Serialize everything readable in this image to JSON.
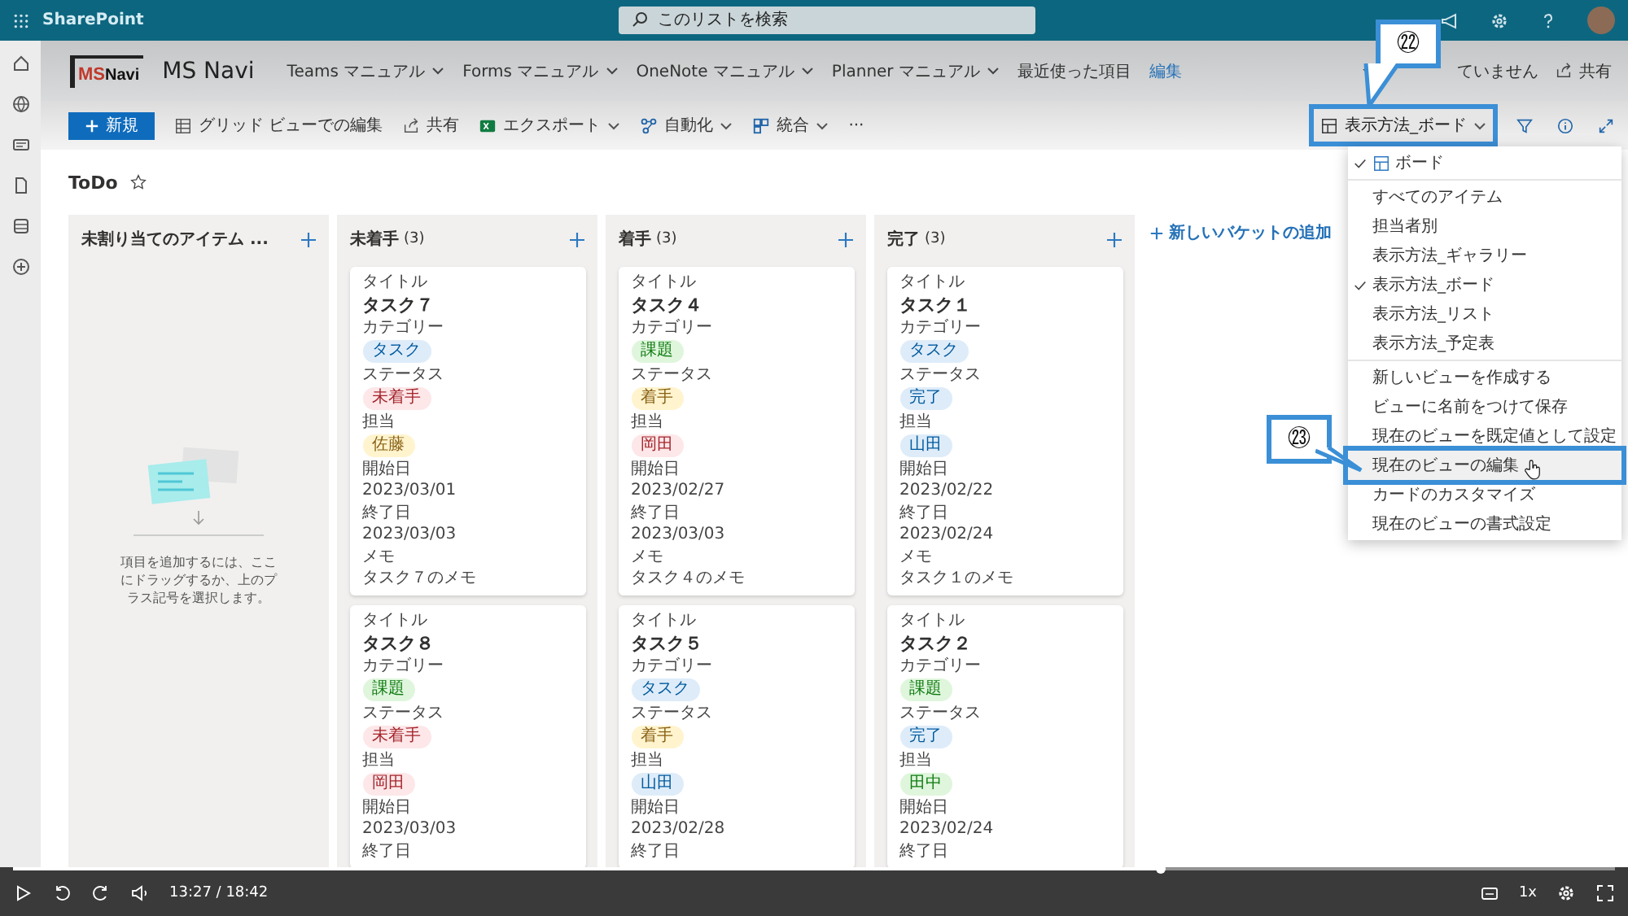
{
  "suite_bar": {
    "app_name": "SharePoint",
    "search": {
      "placeholder": "このリストを検索"
    }
  },
  "site_header": {
    "logo": {
      "mark": "MS",
      "word": "Navi"
    },
    "title": "MS Navi",
    "nav": [
      {
        "label": "Teams マニュアル",
        "dropdown": true
      },
      {
        "label": "Forms マニュアル",
        "dropdown": true
      },
      {
        "label": "OneNote マニュアル",
        "dropdown": true
      },
      {
        "label": "Planner マニュアル",
        "dropdown": true
      },
      {
        "label": "最近使った項目"
      },
      {
        "label": "編集",
        "kind": "link"
      }
    ],
    "follow": "ていません",
    "share": "共有"
  },
  "command_bar": {
    "items": [
      {
        "kind": "primary",
        "label": "新規"
      },
      {
        "kind": "grid",
        "label": "グリッド ビューでの編集"
      },
      {
        "kind": "share",
        "label": "共有"
      },
      {
        "kind": "excel",
        "label": "エクスポート",
        "dropdown": true
      },
      {
        "kind": "flow",
        "label": "自動化",
        "dropdown": true
      },
      {
        "kind": "integrate",
        "label": "統合",
        "dropdown": true
      },
      {
        "kind": "more",
        "label": "···"
      }
    ],
    "view_button": {
      "label": "表示方法_ボード",
      "expanded": true
    }
  },
  "list_title": "ToDo",
  "board": {
    "columns": [
      {
        "title": "未割り当てのアイテム ...",
        "empty_text": "項目を追加するには、ここにドラッグするか、上のプラス記号を選択します。"
      },
      {
        "title": "未着手",
        "count": "(3)",
        "cards": [
          {
            "fields": [
              {
                "kind": "title",
                "label": "タイトル",
                "value": "タスク７"
              },
              {
                "kind": "pill",
                "label": "カテゴリー",
                "value": "タスク",
                "color": "#deecf9"
              },
              {
                "kind": "pill",
                "label": "ステータス",
                "value": "未着手",
                "color": "#fde7e9"
              },
              {
                "kind": "pill",
                "label": "担当",
                "value": "佐藤",
                "color": "#fff4ce"
              },
              {
                "kind": "text",
                "label": "開始日",
                "value": "2023/03/01"
              },
              {
                "kind": "text",
                "label": "終了日",
                "value": "2023/03/03"
              },
              {
                "kind": "text",
                "label": "メモ",
                "value": "タスク７のメモ"
              }
            ]
          },
          {
            "fields": [
              {
                "kind": "title",
                "label": "タイトル",
                "value": "タスク８"
              },
              {
                "kind": "pill",
                "label": "カテゴリー",
                "value": "課題",
                "color": "#dff6dd"
              },
              {
                "kind": "pill",
                "label": "ステータス",
                "value": "未着手",
                "color": "#fde7e9"
              },
              {
                "kind": "pill",
                "label": "担当",
                "value": "岡田",
                "color": "#fde7e9"
              },
              {
                "kind": "text",
                "label": "開始日",
                "value": "2023/03/03"
              },
              {
                "kind": "text",
                "label": "終了日"
              }
            ]
          }
        ]
      },
      {
        "title": "着手",
        "count": "(3)",
        "cards": [
          {
            "fields": [
              {
                "kind": "title",
                "label": "タイトル",
                "value": "タスク４"
              },
              {
                "kind": "pill",
                "label": "カテゴリー",
                "value": "課題",
                "color": "#dff6dd"
              },
              {
                "kind": "pill",
                "label": "ステータス",
                "value": "着手",
                "color": "#fff4ce"
              },
              {
                "kind": "pill",
                "label": "担当",
                "value": "岡田",
                "color": "#fde7e9"
              },
              {
                "kind": "text",
                "label": "開始日",
                "value": "2023/02/27"
              },
              {
                "kind": "text",
                "label": "終了日",
                "value": "2023/03/03"
              },
              {
                "kind": "text",
                "label": "メモ",
                "value": "タスク４のメモ"
              }
            ]
          },
          {
            "fields": [
              {
                "kind": "title",
                "label": "タイトル",
                "value": "タスク５"
              },
              {
                "kind": "pill",
                "label": "カテゴリー",
                "value": "タスク",
                "color": "#deecf9"
              },
              {
                "kind": "pill",
                "label": "ステータス",
                "value": "着手",
                "color": "#fff4ce"
              },
              {
                "kind": "pill",
                "label": "担当",
                "value": "山田",
                "color": "#deecf9"
              },
              {
                "kind": "text",
                "label": "開始日",
                "value": "2023/02/28"
              },
              {
                "kind": "text",
                "label": "終了日"
              }
            ]
          }
        ]
      },
      {
        "title": "完了",
        "count": "(3)",
        "cards": [
          {
            "fields": [
              {
                "kind": "title",
                "label": "タイトル",
                "value": "タスク１"
              },
              {
                "kind": "pill",
                "label": "カテゴリー",
                "value": "タスク",
                "color": "#deecf9"
              },
              {
                "kind": "pill",
                "label": "ステータス",
                "value": "完了",
                "color": "#deecf9"
              },
              {
                "kind": "pill",
                "label": "担当",
                "value": "山田",
                "color": "#deecf9"
              },
              {
                "kind": "text",
                "label": "開始日",
                "value": "2023/02/22"
              },
              {
                "kind": "text",
                "label": "終了日",
                "value": "2023/02/24"
              },
              {
                "kind": "text",
                "label": "メモ",
                "value": "タスク１のメモ"
              }
            ]
          },
          {
            "fields": [
              {
                "kind": "title",
                "label": "タイトル",
                "value": "タスク２"
              },
              {
                "kind": "pill",
                "label": "カテゴリー",
                "value": "課題",
                "color": "#dff6dd"
              },
              {
                "kind": "pill",
                "label": "ステータス",
                "value": "完了",
                "color": "#deecf9"
              },
              {
                "kind": "pill",
                "label": "担当",
                "value": "田中",
                "color": "#dff6dd"
              },
              {
                "kind": "text",
                "label": "開始日",
                "value": "2023/02/24"
              },
              {
                "kind": "text",
                "label": "終了日"
              }
            ]
          }
        ]
      }
    ],
    "add_bucket": "新しいバケットの追加"
  },
  "view_menu": {
    "groups": [
      [
        {
          "label": "ボード",
          "checked": true,
          "hovered": false,
          "icon": true
        }
      ],
      [
        {
          "label": "すべてのアイテム",
          "checked": false,
          "hovered": false
        },
        {
          "label": "担当者別",
          "checked": false,
          "hovered": false
        },
        {
          "label": "表示方法_ギャラリー",
          "checked": false,
          "hovered": false
        },
        {
          "label": "表示方法_ボード",
          "checked": true,
          "hovered": false
        },
        {
          "label": "表示方法_リスト",
          "checked": false,
          "hovered": false
        },
        {
          "label": "表示方法_予定表",
          "checked": false,
          "hovered": false
        }
      ],
      [
        {
          "label": "新しいビューを作成する",
          "checked": false,
          "hovered": false
        },
        {
          "label": "ビューに名前をつけて保存",
          "checked": false,
          "hovered": false
        },
        {
          "label": "現在のビューを既定値として設定",
          "checked": false,
          "hovered": false
        },
        {
          "label": "現在のビューの編集",
          "checked": false,
          "hovered": true
        },
        {
          "label": "カードのカスタマイズ",
          "checked": false,
          "hovered": false
        },
        {
          "label": "現在のビューの書式設定",
          "checked": false,
          "hovered": false
        }
      ]
    ]
  },
  "annotations": [
    {
      "label": "㉒"
    },
    {
      "label": "㉓"
    }
  ],
  "video_player": {
    "progress": {
      "level": 0.716
    },
    "time": "13:27 / 18:42",
    "speed": "1x"
  }
}
